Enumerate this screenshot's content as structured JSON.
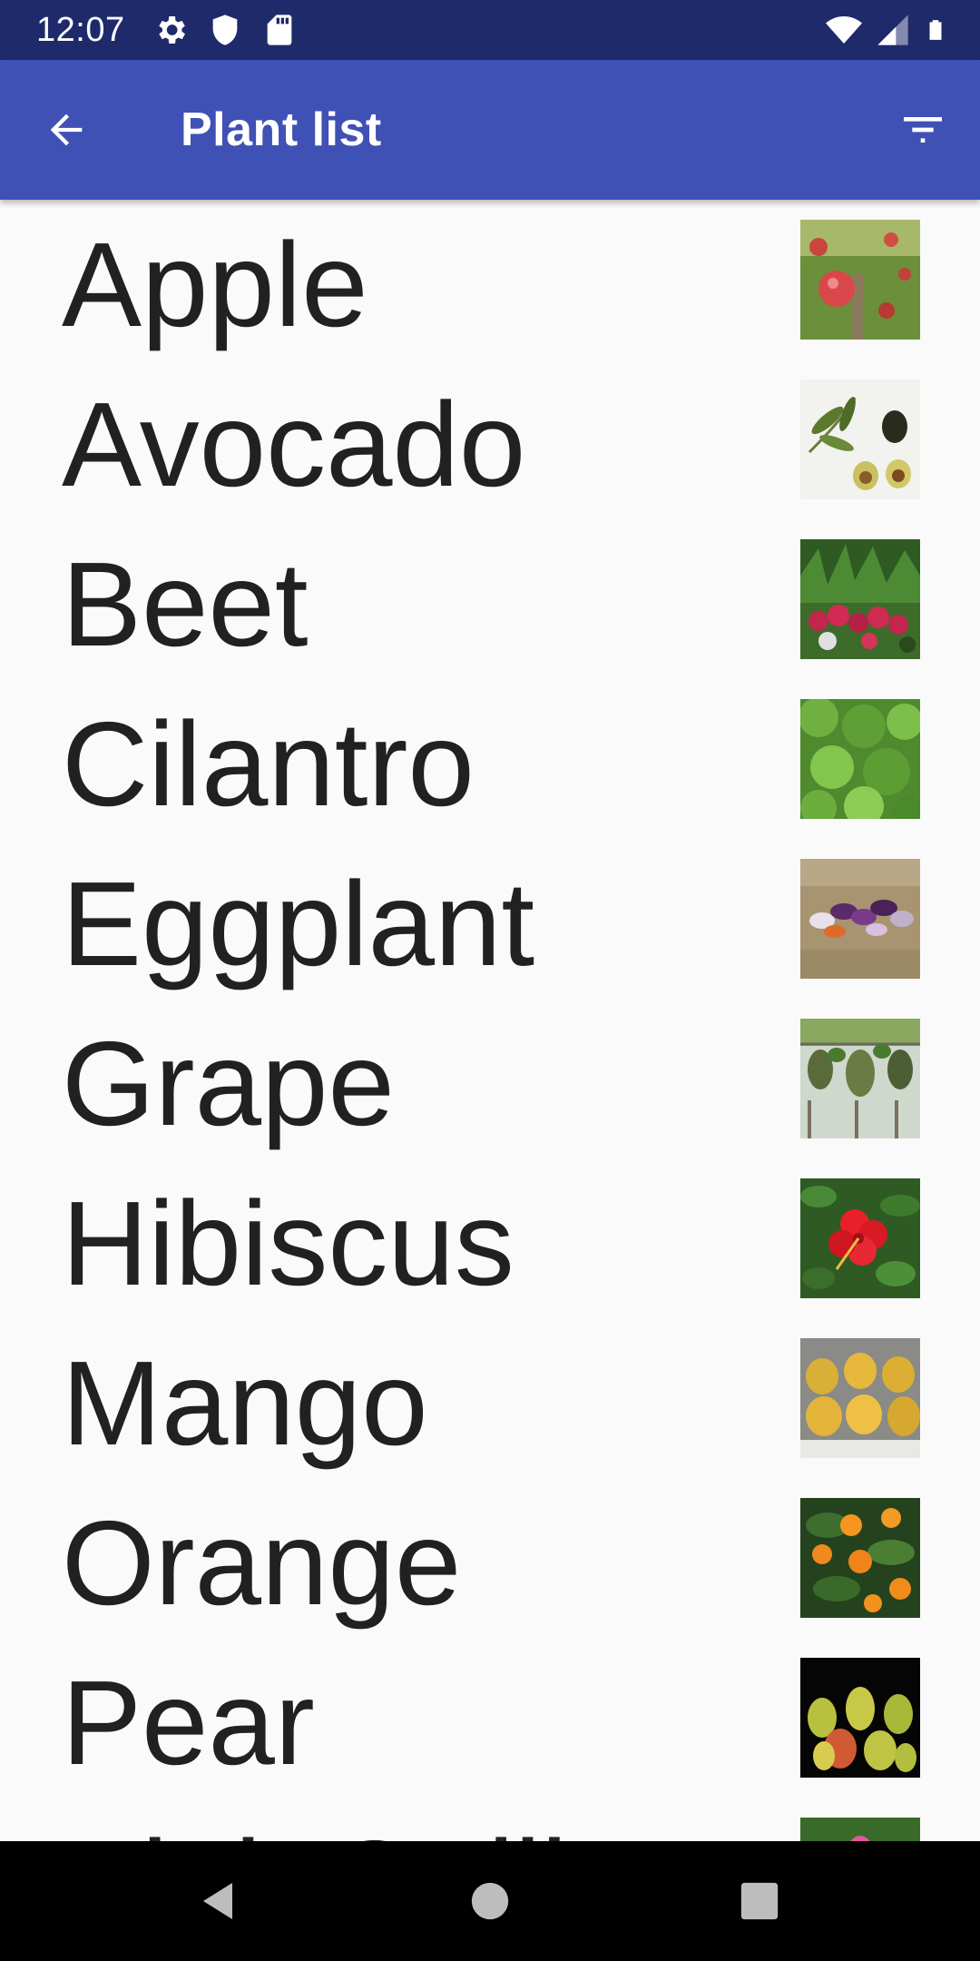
{
  "status_bar": {
    "time": "12:07",
    "left_icons": [
      "gear-icon",
      "shield-icon",
      "sd-card-icon"
    ],
    "right_icons": [
      "wifi-icon",
      "cell-signal-icon",
      "battery-icon"
    ]
  },
  "app_bar": {
    "title": "Plant list",
    "back_icon": "arrow-back-icon",
    "filter_icon": "filter-list-icon",
    "color": "#3f51b5"
  },
  "plants": [
    {
      "name": "Apple",
      "image": "apple-tree-photo"
    },
    {
      "name": "Avocado",
      "image": "avocado-photo"
    },
    {
      "name": "Beet",
      "image": "beet-photo"
    },
    {
      "name": "Cilantro",
      "image": "cilantro-photo"
    },
    {
      "name": "Eggplant",
      "image": "eggplant-photo"
    },
    {
      "name": "Grape",
      "image": "grape-vine-photo"
    },
    {
      "name": "Hibiscus",
      "image": "hibiscus-flower-photo"
    },
    {
      "name": "Mango",
      "image": "mango-photo"
    },
    {
      "name": "Orange",
      "image": "orange-tree-photo"
    },
    {
      "name": "Pear",
      "image": "pear-photo"
    },
    {
      "name": "Pink Quill",
      "image": "pink-quill-photo"
    }
  ],
  "nav_bar": {
    "buttons": [
      "back-triangle-icon",
      "home-circle-icon",
      "recents-square-icon"
    ]
  }
}
